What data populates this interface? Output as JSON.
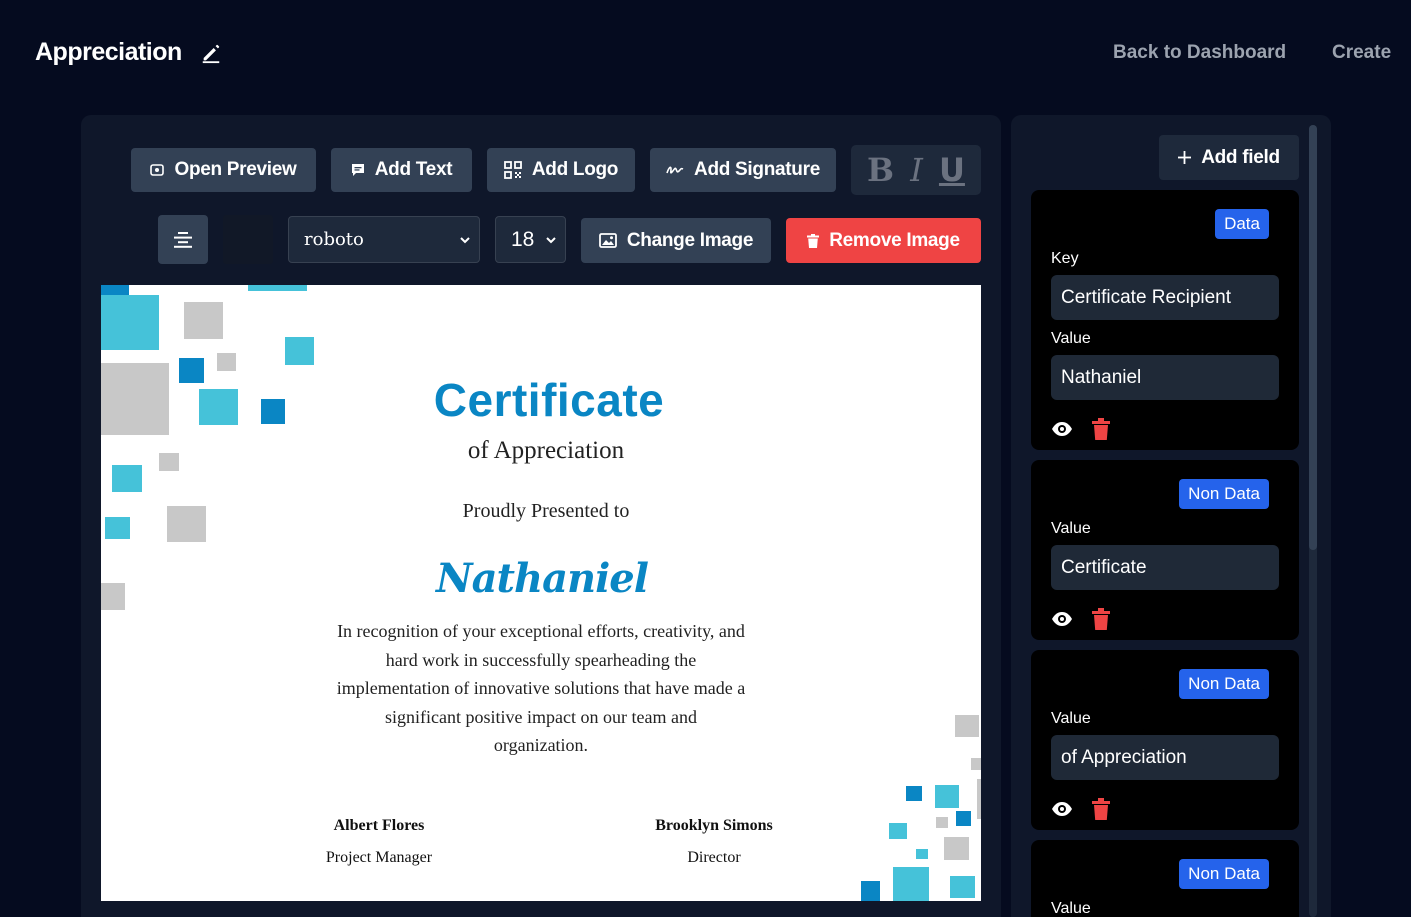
{
  "header": {
    "title": "Appreciation",
    "nav": {
      "back": "Back to Dashboard",
      "create": "Create"
    }
  },
  "toolbar": {
    "open_preview": "Open Preview",
    "add_text": "Add Text",
    "add_logo": "Add Logo",
    "add_signature": "Add Signature",
    "bold": "B",
    "italic": "I",
    "underline": "U",
    "font_family": "roboto",
    "font_size": "18",
    "text_color": "#111827",
    "change_image": "Change Image",
    "remove_image": "Remove Image"
  },
  "certificate": {
    "title": "Certificate",
    "subtitle": "of Appreciation",
    "presented": "Proudly Presented to",
    "recipient": "Nathaniel",
    "body": "In recognition of your exceptional efforts, creativity, and hard work in successfully spearheading the implementation of innovative solutions that have made a significant positive impact on our team and organization.",
    "signatures": [
      {
        "name": "Albert Flores",
        "role": "Project Manager"
      },
      {
        "name": "Brooklyn Simons",
        "role": "Director"
      }
    ],
    "accent_color": "#0a86c4"
  },
  "fields_panel": {
    "add_field": "Add field",
    "fields": [
      {
        "type": "Data",
        "key_label": "Key",
        "key": "Certificate Recipient",
        "value_label": "Value",
        "value": "Nathaniel"
      },
      {
        "type": "Non Data",
        "value_label": "Value",
        "value": "Certificate"
      },
      {
        "type": "Non Data",
        "value_label": "Value",
        "value": "of Appreciation"
      },
      {
        "type": "Non Data",
        "value_label": "Value"
      }
    ]
  },
  "colors": {
    "background": "#050b1f",
    "panel": "#0f172a",
    "button": "#334155",
    "danger": "#ef4444",
    "badge": "#2563eb"
  }
}
